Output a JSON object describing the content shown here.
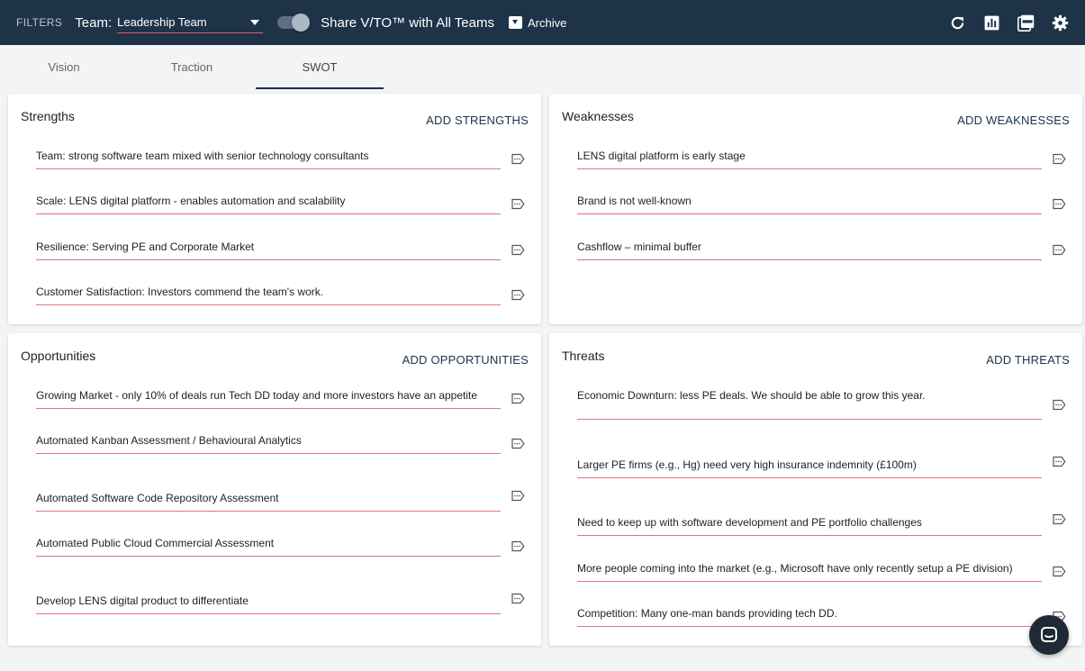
{
  "topbar": {
    "filters_label": "FILTERS",
    "team_label": "Team:",
    "team_value": "Leadership Team",
    "share_label": "Share V/TO™ with All Teams",
    "archive_label": "Archive"
  },
  "tabs": [
    "Vision",
    "Traction",
    "SWOT"
  ],
  "active_tab": "SWOT",
  "colors": {
    "topbar": "#1e3348",
    "underline": "#e57373",
    "accent": "#1e3348"
  },
  "swot": {
    "strengths": {
      "title": "Strengths",
      "add_label": "ADD STRENGTHS",
      "items": [
        "Team: strong software team mixed with senior technology consultants",
        "Scale: LENS digital platform - enables automation and scalability",
        "Resilience: Serving PE and Corporate Market",
        "Customer Satisfaction: Investors commend the team's work."
      ]
    },
    "weaknesses": {
      "title": "Weaknesses",
      "add_label": "ADD WEAKNESSES",
      "items": [
        "LENS digital platform is early stage",
        "Brand is not well-known",
        "Cashflow – minimal buffer"
      ]
    },
    "opportunities": {
      "title": "Opportunities",
      "add_label": "ADD OPPORTUNITIES",
      "items": [
        "Growing Market - only 10% of deals run Tech DD today and more investors have an appetite",
        "Automated Kanban Assessment / Behavioural Analytics",
        "Automated Software Code Repository Assessment",
        "Automated Public Cloud Commercial Assessment",
        "Develop LENS digital product to differentiate"
      ]
    },
    "threats": {
      "title": "Threats",
      "add_label": "ADD THREATS",
      "items": [
        "Economic Downturn: less PE deals.  We should be able to grow this year.",
        "Larger PE firms (e.g., Hg) need very high insurance indemnity (£100m)",
        "Need to keep up with software development and PE portfolio challenges",
        "More people coming into the market (e.g., Microsoft have only recently setup a PE division)",
        "Competition: Many one-man bands providing tech DD."
      ]
    }
  }
}
